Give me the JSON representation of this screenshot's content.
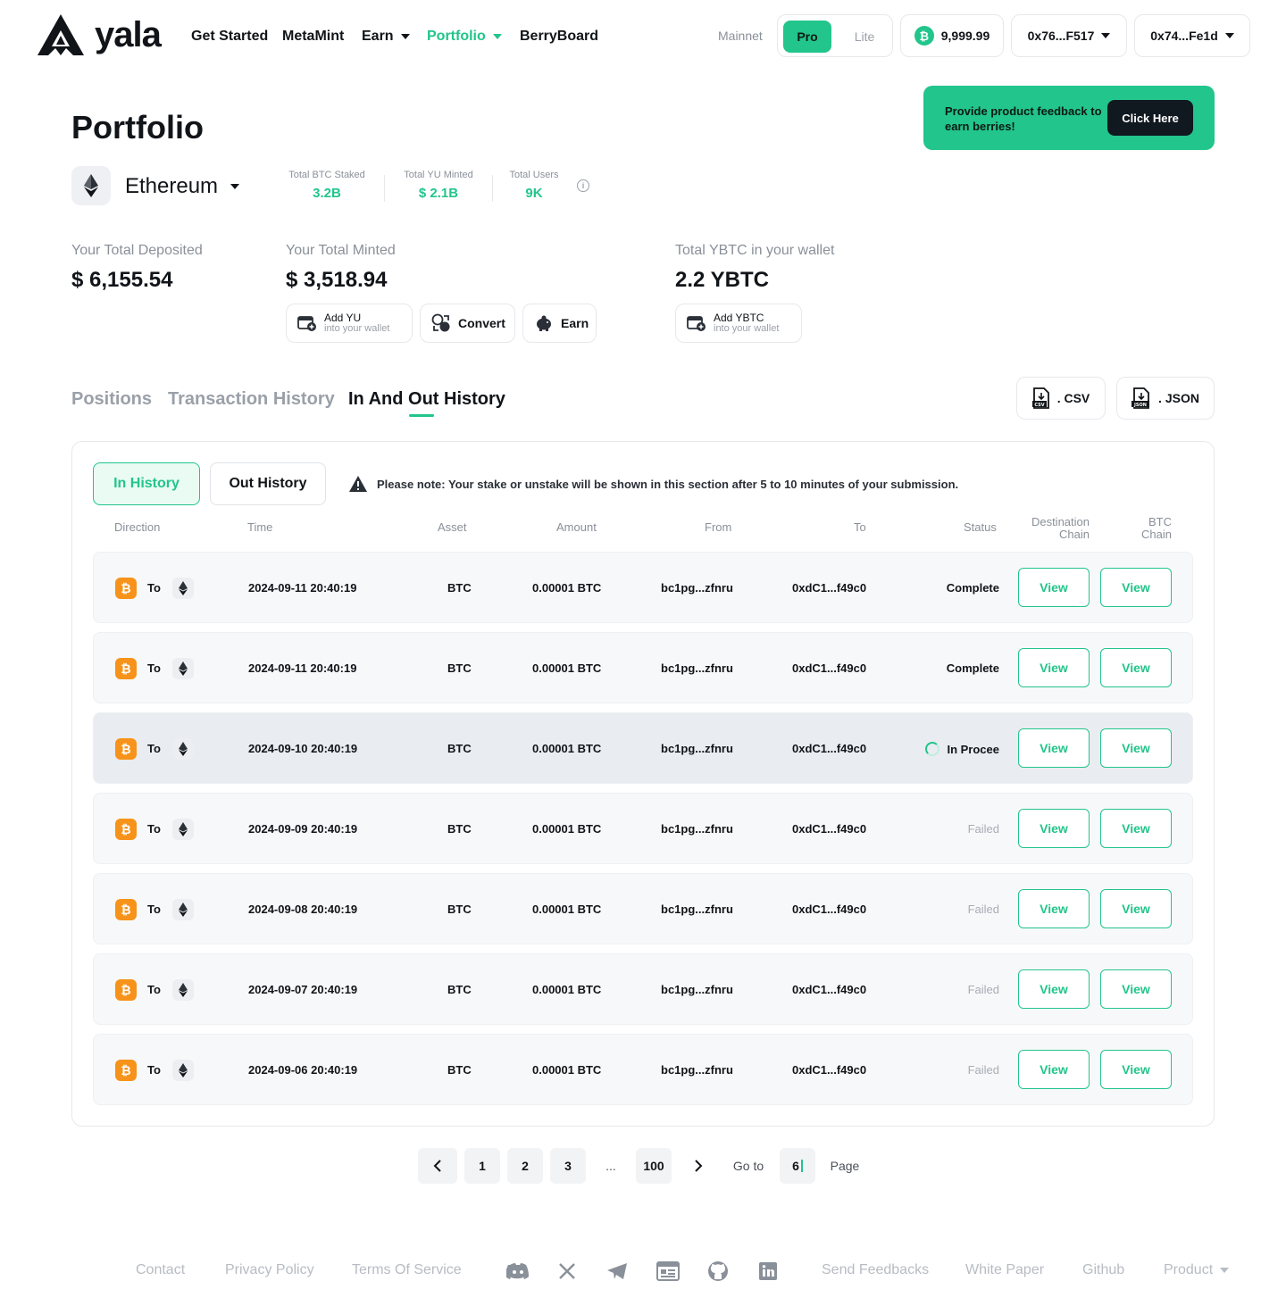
{
  "brand": {
    "name": "yala"
  },
  "nav": {
    "items": [
      {
        "label": "Get Started"
      },
      {
        "label": "MetaMint"
      },
      {
        "label": "Earn"
      },
      {
        "label": "Portfolio"
      },
      {
        "label": "BerryBoard"
      }
    ]
  },
  "header": {
    "network_label": "Mainnet",
    "mode_pro": "Pro",
    "mode_lite": "Lite",
    "btc_balance": "9,999.99",
    "wallet_btc": "0x76...F517",
    "wallet_eth": "0x74...Fe1d"
  },
  "feedback": {
    "text": "Provide product feedback to earn berries!",
    "button": "Click Here"
  },
  "page": {
    "title": "Portfolio",
    "chain": "Ethereum"
  },
  "stats": [
    {
      "label": "Total BTC Staked",
      "value": "3.2B"
    },
    {
      "label": "Total YU Minted",
      "value": "$ 2.1B"
    },
    {
      "label": "Total Users",
      "value": "9K"
    }
  ],
  "summary": {
    "deposited_label": "Your Total Deposited",
    "deposited_value": "$ 6,155.54",
    "minted_label": "Your Total Minted",
    "minted_value": "$ 3,518.94",
    "ybtc_label": "Total YBTC in your wallet",
    "ybtc_value": "2.2 YBTC"
  },
  "actions": {
    "add_yu_title": "Add YU",
    "add_yu_sub": "into your wallet",
    "convert": "Convert",
    "earn": "Earn",
    "add_ybtc_title": "Add YBTC",
    "add_ybtc_sub": "into your wallet"
  },
  "tabs": {
    "positions": "Positions",
    "transactions": "Transaction History",
    "in_out": "In And Out History"
  },
  "export": {
    "csv": ". CSV",
    "json": ". JSON"
  },
  "history": {
    "in_tab": "In History",
    "out_tab": "Out History",
    "note": "Please note: Your stake or unstake will be shown in this section after 5 to 10 minutes of your submission.",
    "columns": {
      "direction": "Direction",
      "time": "Time",
      "asset": "Asset",
      "amount": "Amount",
      "from": "From",
      "to": "To",
      "status": "Status",
      "dest_chain_1": "Destination",
      "dest_chain_2": "Chain",
      "btc_chain_1": "BTC",
      "btc_chain_2": "Chain"
    },
    "rows": [
      {
        "direction": "To",
        "time": "2024-09-11 20:40:19",
        "asset": "BTC",
        "amount": "0.00001 BTC",
        "from": "bc1pg...zfnru",
        "to": "0xdC1...f49c0",
        "status": "Complete",
        "dest_btn": "View",
        "btc_btn": "View"
      },
      {
        "direction": "To",
        "time": "2024-09-11 20:40:19",
        "asset": "BTC",
        "amount": "0.00001 BTC",
        "from": "bc1pg...zfnru",
        "to": "0xdC1...f49c0",
        "status": "Complete",
        "dest_btn": "View",
        "btc_btn": "View"
      },
      {
        "direction": "To",
        "time": "2024-09-10 20:40:19",
        "asset": "BTC",
        "amount": "0.00001 BTC",
        "from": "bc1pg...zfnru",
        "to": "0xdC1...f49c0",
        "status": "In Procee",
        "dest_btn": "View",
        "btc_btn": "View"
      },
      {
        "direction": "To",
        "time": "2024-09-09 20:40:19",
        "asset": "BTC",
        "amount": "0.00001 BTC",
        "from": "bc1pg...zfnru",
        "to": "0xdC1...f49c0",
        "status": "Failed",
        "dest_btn": "View",
        "btc_btn": "View"
      },
      {
        "direction": "To",
        "time": "2024-09-08 20:40:19",
        "asset": "BTC",
        "amount": "0.00001 BTC",
        "from": "bc1pg...zfnru",
        "to": "0xdC1...f49c0",
        "status": "Failed",
        "dest_btn": "View",
        "btc_btn": "View"
      },
      {
        "direction": "To",
        "time": "2024-09-07 20:40:19",
        "asset": "BTC",
        "amount": "0.00001 BTC",
        "from": "bc1pg...zfnru",
        "to": "0xdC1...f49c0",
        "status": "Failed",
        "dest_btn": "View",
        "btc_btn": "View"
      },
      {
        "direction": "To",
        "time": "2024-09-06 20:40:19",
        "asset": "BTC",
        "amount": "0.00001 BTC",
        "from": "bc1pg...zfnru",
        "to": "0xdC1...f49c0",
        "status": "Failed",
        "dest_btn": "View",
        "btc_btn": "View"
      }
    ]
  },
  "pagination": {
    "pages": [
      "1",
      "2",
      "3"
    ],
    "ellipsis": "...",
    "last": "100",
    "goto_label": "Go to",
    "goto_value": "6",
    "page_label": "Page"
  },
  "footer": {
    "contact": "Contact",
    "privacy": "Privacy Policy",
    "terms": "Terms Of Service",
    "feedbacks": "Send Feedbacks",
    "whitepaper": "White Paper",
    "github": "Github",
    "product": "Product",
    "social_icons": [
      "discord-icon",
      "x-icon",
      "telegram-icon",
      "news-icon",
      "github-icon",
      "linkedin-icon"
    ]
  },
  "colors": {
    "accent": "#22c58b",
    "btc": "#f7931a",
    "dark": "#101820",
    "muted": "#8a9099"
  }
}
